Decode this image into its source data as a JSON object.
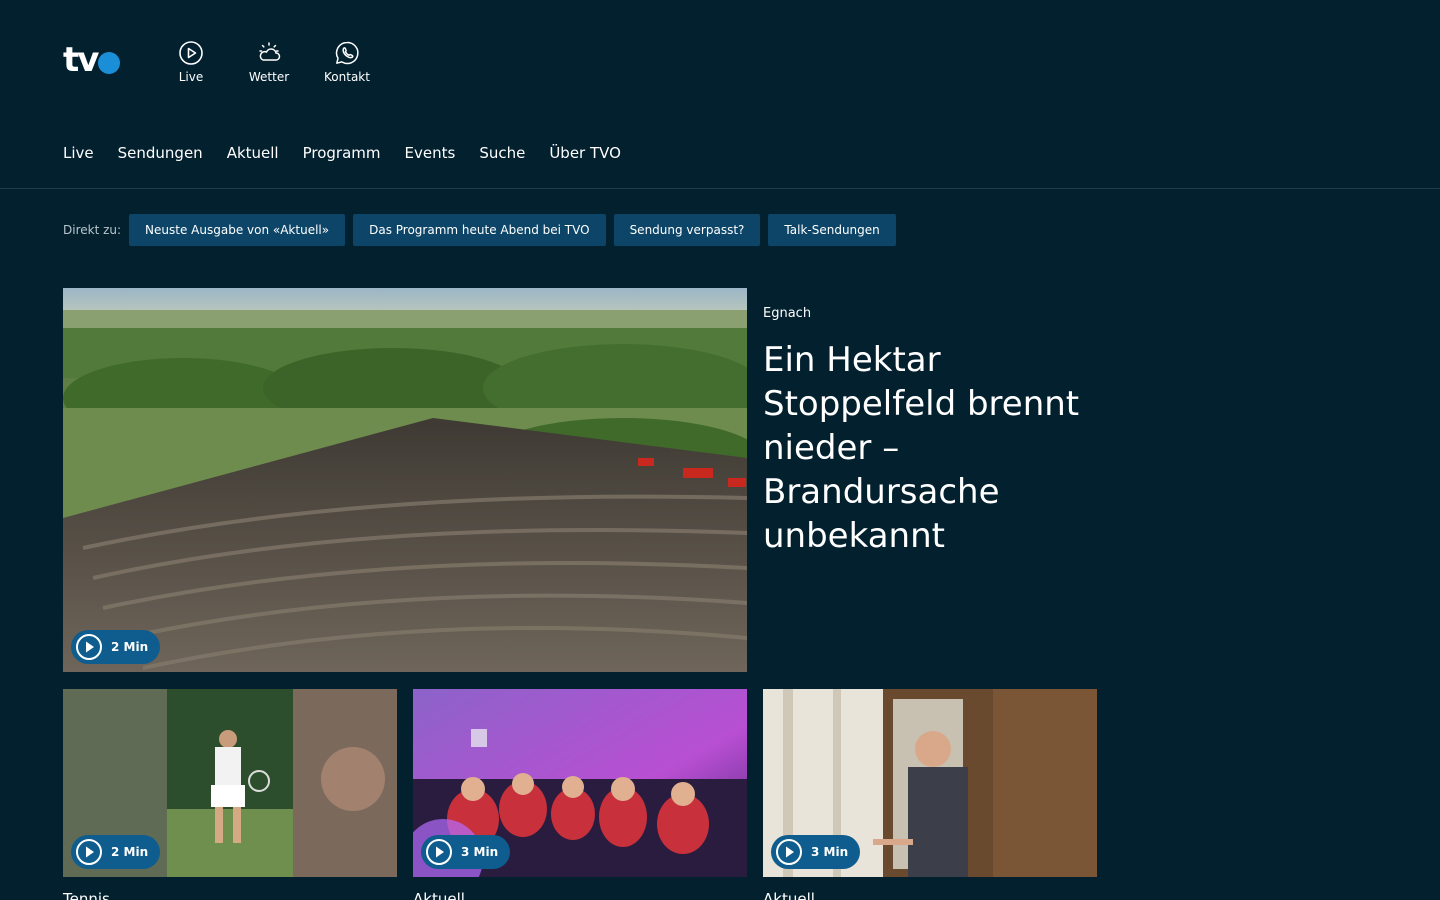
{
  "header": {
    "logo_text": "tv",
    "quick_links": [
      {
        "label": "Live",
        "icon": "play-circle-icon"
      },
      {
        "label": "Wetter",
        "icon": "weather-sun-cloud-icon"
      },
      {
        "label": "Kontakt",
        "icon": "whatsapp-phone-icon"
      }
    ]
  },
  "nav": {
    "items": [
      "Live",
      "Sendungen",
      "Aktuell",
      "Programm",
      "Events",
      "Suche",
      "Über TVO"
    ]
  },
  "direkt": {
    "label": "Direkt zu:",
    "chips": [
      "Neuste Ausgabe von «Aktuell»",
      "Das Programm heute Abend bei TVO",
      "Sendung verpasst?",
      "Talk-Sendungen"
    ]
  },
  "hero": {
    "kicker": "Egnach",
    "title": "Ein Hektar Stoppelfeld brennt nieder – Brandursache unbekannt",
    "duration": "2 Min",
    "image": "aerial-burned-stubble-field"
  },
  "cards": [
    {
      "kicker": "Tennis",
      "duration": "2 Min",
      "image": "tennis-player-grass-court"
    },
    {
      "kicker": "Aktuell",
      "duration": "3 Min",
      "image": "crowd-party-purple-lights"
    },
    {
      "kicker": "Aktuell",
      "duration": "3 Min",
      "image": "man-at-window-wooden-room"
    }
  ],
  "colors": {
    "background": "#03202f",
    "chip": "#0c4568",
    "play_badge": "#0e5d8e",
    "logo_dot": "#1a8fd8"
  }
}
